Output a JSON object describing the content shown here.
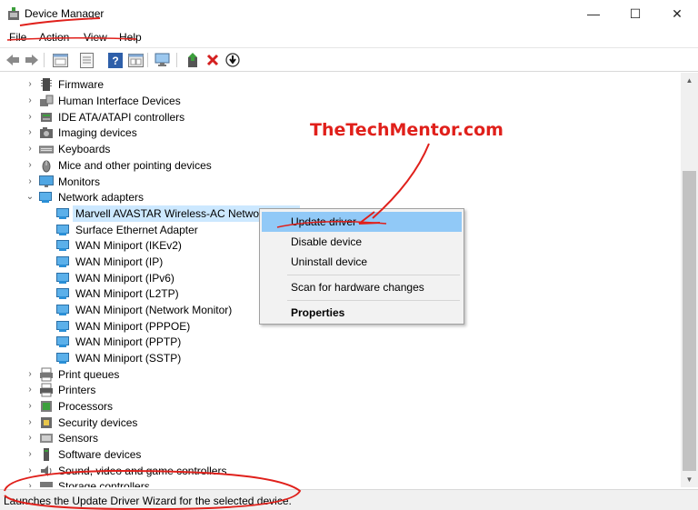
{
  "window": {
    "title": "Device Manager",
    "minimize_glyph": "—",
    "maximize_glyph": "☐",
    "close_glyph": "✕"
  },
  "menu": [
    "File",
    "Action",
    "View",
    "Help"
  ],
  "toolbar": {
    "buttons": [
      "back-icon",
      "forward-icon",
      "properties-view-icon",
      "details-icon",
      "help-icon",
      "window-icon",
      "scan-hardware-icon",
      "update-driver-icon",
      "uninstall-icon",
      "download-icon"
    ]
  },
  "tree": {
    "categories": [
      {
        "label": "Firmware",
        "icon": "firmware-icon",
        "expanded": false
      },
      {
        "label": "Human Interface Devices",
        "icon": "hid-icon",
        "expanded": false
      },
      {
        "label": "IDE ATA/ATAPI controllers",
        "icon": "ide-icon",
        "expanded": false
      },
      {
        "label": "Imaging devices",
        "icon": "camera-icon",
        "expanded": false
      },
      {
        "label": "Keyboards",
        "icon": "keyboard-icon",
        "expanded": false
      },
      {
        "label": "Mice and other pointing devices",
        "icon": "mouse-icon",
        "expanded": false
      },
      {
        "label": "Monitors",
        "icon": "monitor-icon",
        "expanded": false
      },
      {
        "label": "Network adapters",
        "icon": "network-icon",
        "expanded": true
      }
    ],
    "network_children": [
      "Marvell AVASTAR Wireless-AC Network C",
      "Surface Ethernet Adapter",
      "WAN Miniport (IKEv2)",
      "WAN Miniport (IP)",
      "WAN Miniport (IPv6)",
      "WAN Miniport (L2TP)",
      "WAN Miniport (Network Monitor)",
      "WAN Miniport (PPPOE)",
      "WAN Miniport (PPTP)",
      "WAN Miniport (SSTP)"
    ],
    "categories_after": [
      {
        "label": "Print queues",
        "icon": "print-queue-icon"
      },
      {
        "label": "Printers",
        "icon": "printer-icon"
      },
      {
        "label": "Processors",
        "icon": "processor-icon"
      },
      {
        "label": "Security devices",
        "icon": "security-icon"
      },
      {
        "label": "Sensors",
        "icon": "sensor-icon"
      },
      {
        "label": "Software devices",
        "icon": "software-icon"
      },
      {
        "label": "Sound, video and game controllers",
        "icon": "sound-icon"
      },
      {
        "label": "Storage controllers",
        "icon": "storage-icon"
      }
    ]
  },
  "context_menu": {
    "items": [
      "Update driver",
      "Disable device",
      "Uninstall device",
      "Scan for hardware changes",
      "Properties"
    ]
  },
  "status": "Launches the Update Driver Wizard for the selected device.",
  "annotation": {
    "brand": "TheTechMentor.com",
    "color": "#e0201b"
  },
  "colors": {
    "selection": "#cce8ff",
    "menu_highlight": "#91c9f7",
    "network_icon": "#2a8fd6"
  }
}
